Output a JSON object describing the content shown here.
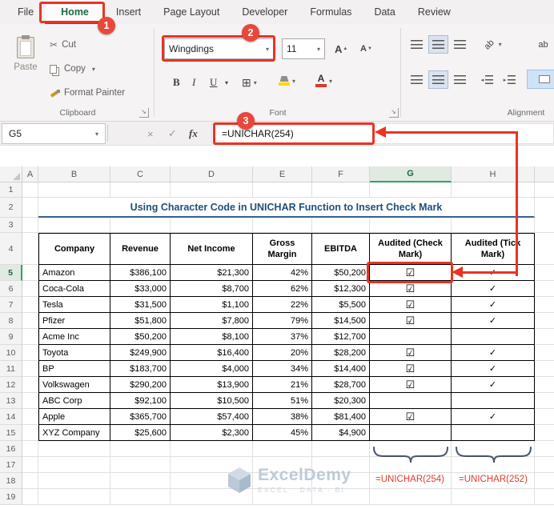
{
  "tabs": {
    "items": [
      {
        "label": "File",
        "active": false
      },
      {
        "label": "Home",
        "active": true
      },
      {
        "label": "Insert",
        "active": false
      },
      {
        "label": "Page Layout",
        "active": false
      },
      {
        "label": "Developer",
        "active": false
      },
      {
        "label": "Formulas",
        "active": false
      },
      {
        "label": "Data",
        "active": false
      },
      {
        "label": "Review",
        "active": false
      }
    ]
  },
  "icons": {
    "dropdown": "▾",
    "cut": "✂",
    "launcher": "↘",
    "border": "⊞",
    "letter_a": "A",
    "up": "▲",
    "down": "▼",
    "ab": "ab"
  },
  "ribbon": {
    "clipboard": {
      "label": "Clipboard",
      "paste": "Paste",
      "cut": "Cut",
      "copy": "Copy",
      "format_painter": "Format Painter"
    },
    "font": {
      "label": "Font",
      "font_name": "Wingdings",
      "font_size": "11",
      "bold": "B",
      "italic": "I",
      "underline": "U"
    },
    "alignment": {
      "label": "Alignment"
    }
  },
  "formula_bar": {
    "name_box": "G5",
    "formula": "=UNICHAR(254)",
    "cancel_icon": "×",
    "enter_icon": "✓",
    "fx_icon": "fx"
  },
  "annotations": {
    "step1": "1",
    "step2": "2",
    "step3": "3",
    "brace_label_g": "=UNICHAR(254)",
    "brace_label_h": "=UNICHAR(252)"
  },
  "sheet": {
    "column_letters": [
      "A",
      "B",
      "C",
      "D",
      "E",
      "F",
      "G",
      "H"
    ],
    "row_count": 19,
    "selected_column": "G",
    "selected_row": 5,
    "title": "Using Character Code in UNICHAR Function to Insert Check Mark",
    "table": {
      "headers": [
        "Company",
        "Revenue",
        "Net Income",
        "Gross Margin",
        "EBITDA",
        "Audited (Check Mark)",
        "Audited (Tick Mark)"
      ],
      "rows": [
        [
          "Amazon",
          "$386,100",
          "$21,300",
          "42%",
          "$50,200",
          "☑",
          "✓"
        ],
        [
          "Coca-Cola",
          "$33,000",
          "$8,700",
          "62%",
          "$12,300",
          "☑",
          "✓"
        ],
        [
          "Tesla",
          "$31,500",
          "$1,100",
          "22%",
          "$5,500",
          "☑",
          "✓"
        ],
        [
          "Pfizer",
          "$51,800",
          "$7,800",
          "79%",
          "$14,500",
          "☑",
          "✓"
        ],
        [
          "Acme Inc",
          "$50,200",
          "$8,100",
          "37%",
          "$12,700",
          "",
          ""
        ],
        [
          "Toyota",
          "$249,900",
          "$16,400",
          "20%",
          "$28,200",
          "☑",
          "✓"
        ],
        [
          "BP",
          "$183,700",
          "$4,000",
          "34%",
          "$14,400",
          "☑",
          "✓"
        ],
        [
          "Volkswagen",
          "$290,200",
          "$13,900",
          "21%",
          "$28,700",
          "☑",
          "✓"
        ],
        [
          "ABC Corp",
          "$92,100",
          "$10,500",
          "51%",
          "$20,300",
          "",
          ""
        ],
        [
          "Apple",
          "$365,700",
          "$57,400",
          "38%",
          "$81,400",
          "☑",
          "✓"
        ],
        [
          "XYZ Company",
          "$25,600",
          "$2,300",
          "45%",
          "$4,900",
          "",
          ""
        ]
      ]
    }
  },
  "watermark": {
    "brand": "ExcelDemy",
    "tagline": "EXCEL · DATA · BI"
  }
}
